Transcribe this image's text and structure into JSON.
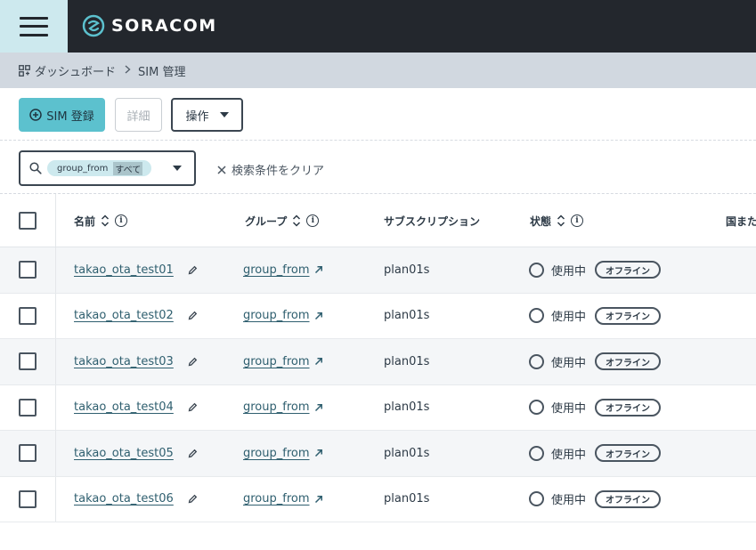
{
  "brand": {
    "name": "SORACOM"
  },
  "breadcrumb": {
    "dashboard": "ダッシュボード",
    "current": "SIM 管理"
  },
  "toolbar": {
    "register_label": "SIM 登録",
    "details_label": "詳細",
    "operations_label": "操作"
  },
  "search": {
    "filter_key": "group_from",
    "filter_value": "すべて",
    "clear_label": "検索条件をクリア"
  },
  "table": {
    "columns": {
      "name": "名前",
      "group": "グループ",
      "subscription": "サブスクリプション",
      "status": "状態",
      "country": "国また"
    },
    "rows": [
      {
        "name": "takao_ota_test01",
        "group": "group_from",
        "subscription": "plan01s",
        "status": "使用中",
        "badge": "オフライン"
      },
      {
        "name": "takao_ota_test02",
        "group": "group_from",
        "subscription": "plan01s",
        "status": "使用中",
        "badge": "オフライン"
      },
      {
        "name": "takao_ota_test03",
        "group": "group_from",
        "subscription": "plan01s",
        "status": "使用中",
        "badge": "オフライン"
      },
      {
        "name": "takao_ota_test04",
        "group": "group_from",
        "subscription": "plan01s",
        "status": "使用中",
        "badge": "オフライン"
      },
      {
        "name": "takao_ota_test05",
        "group": "group_from",
        "subscription": "plan01s",
        "status": "使用中",
        "badge": "オフライン"
      },
      {
        "name": "takao_ota_test06",
        "group": "group_from",
        "subscription": "plan01s",
        "status": "使用中",
        "badge": "オフライン"
      }
    ]
  },
  "colors": {
    "topbar": "#23272d",
    "menu_button": "#cde9ee",
    "primary_button": "#5cc1ce",
    "breadcrumb_bg": "#d1d8e0"
  },
  "icons": [
    "menu-icon",
    "soracom-logo-icon",
    "dashboard-grid-icon",
    "chevron-right-icon",
    "plus-circle-icon",
    "caret-down-icon",
    "search-icon",
    "close-icon",
    "sort-icon",
    "info-icon",
    "edit-pencil-icon",
    "external-link-icon",
    "status-circle-icon"
  ]
}
